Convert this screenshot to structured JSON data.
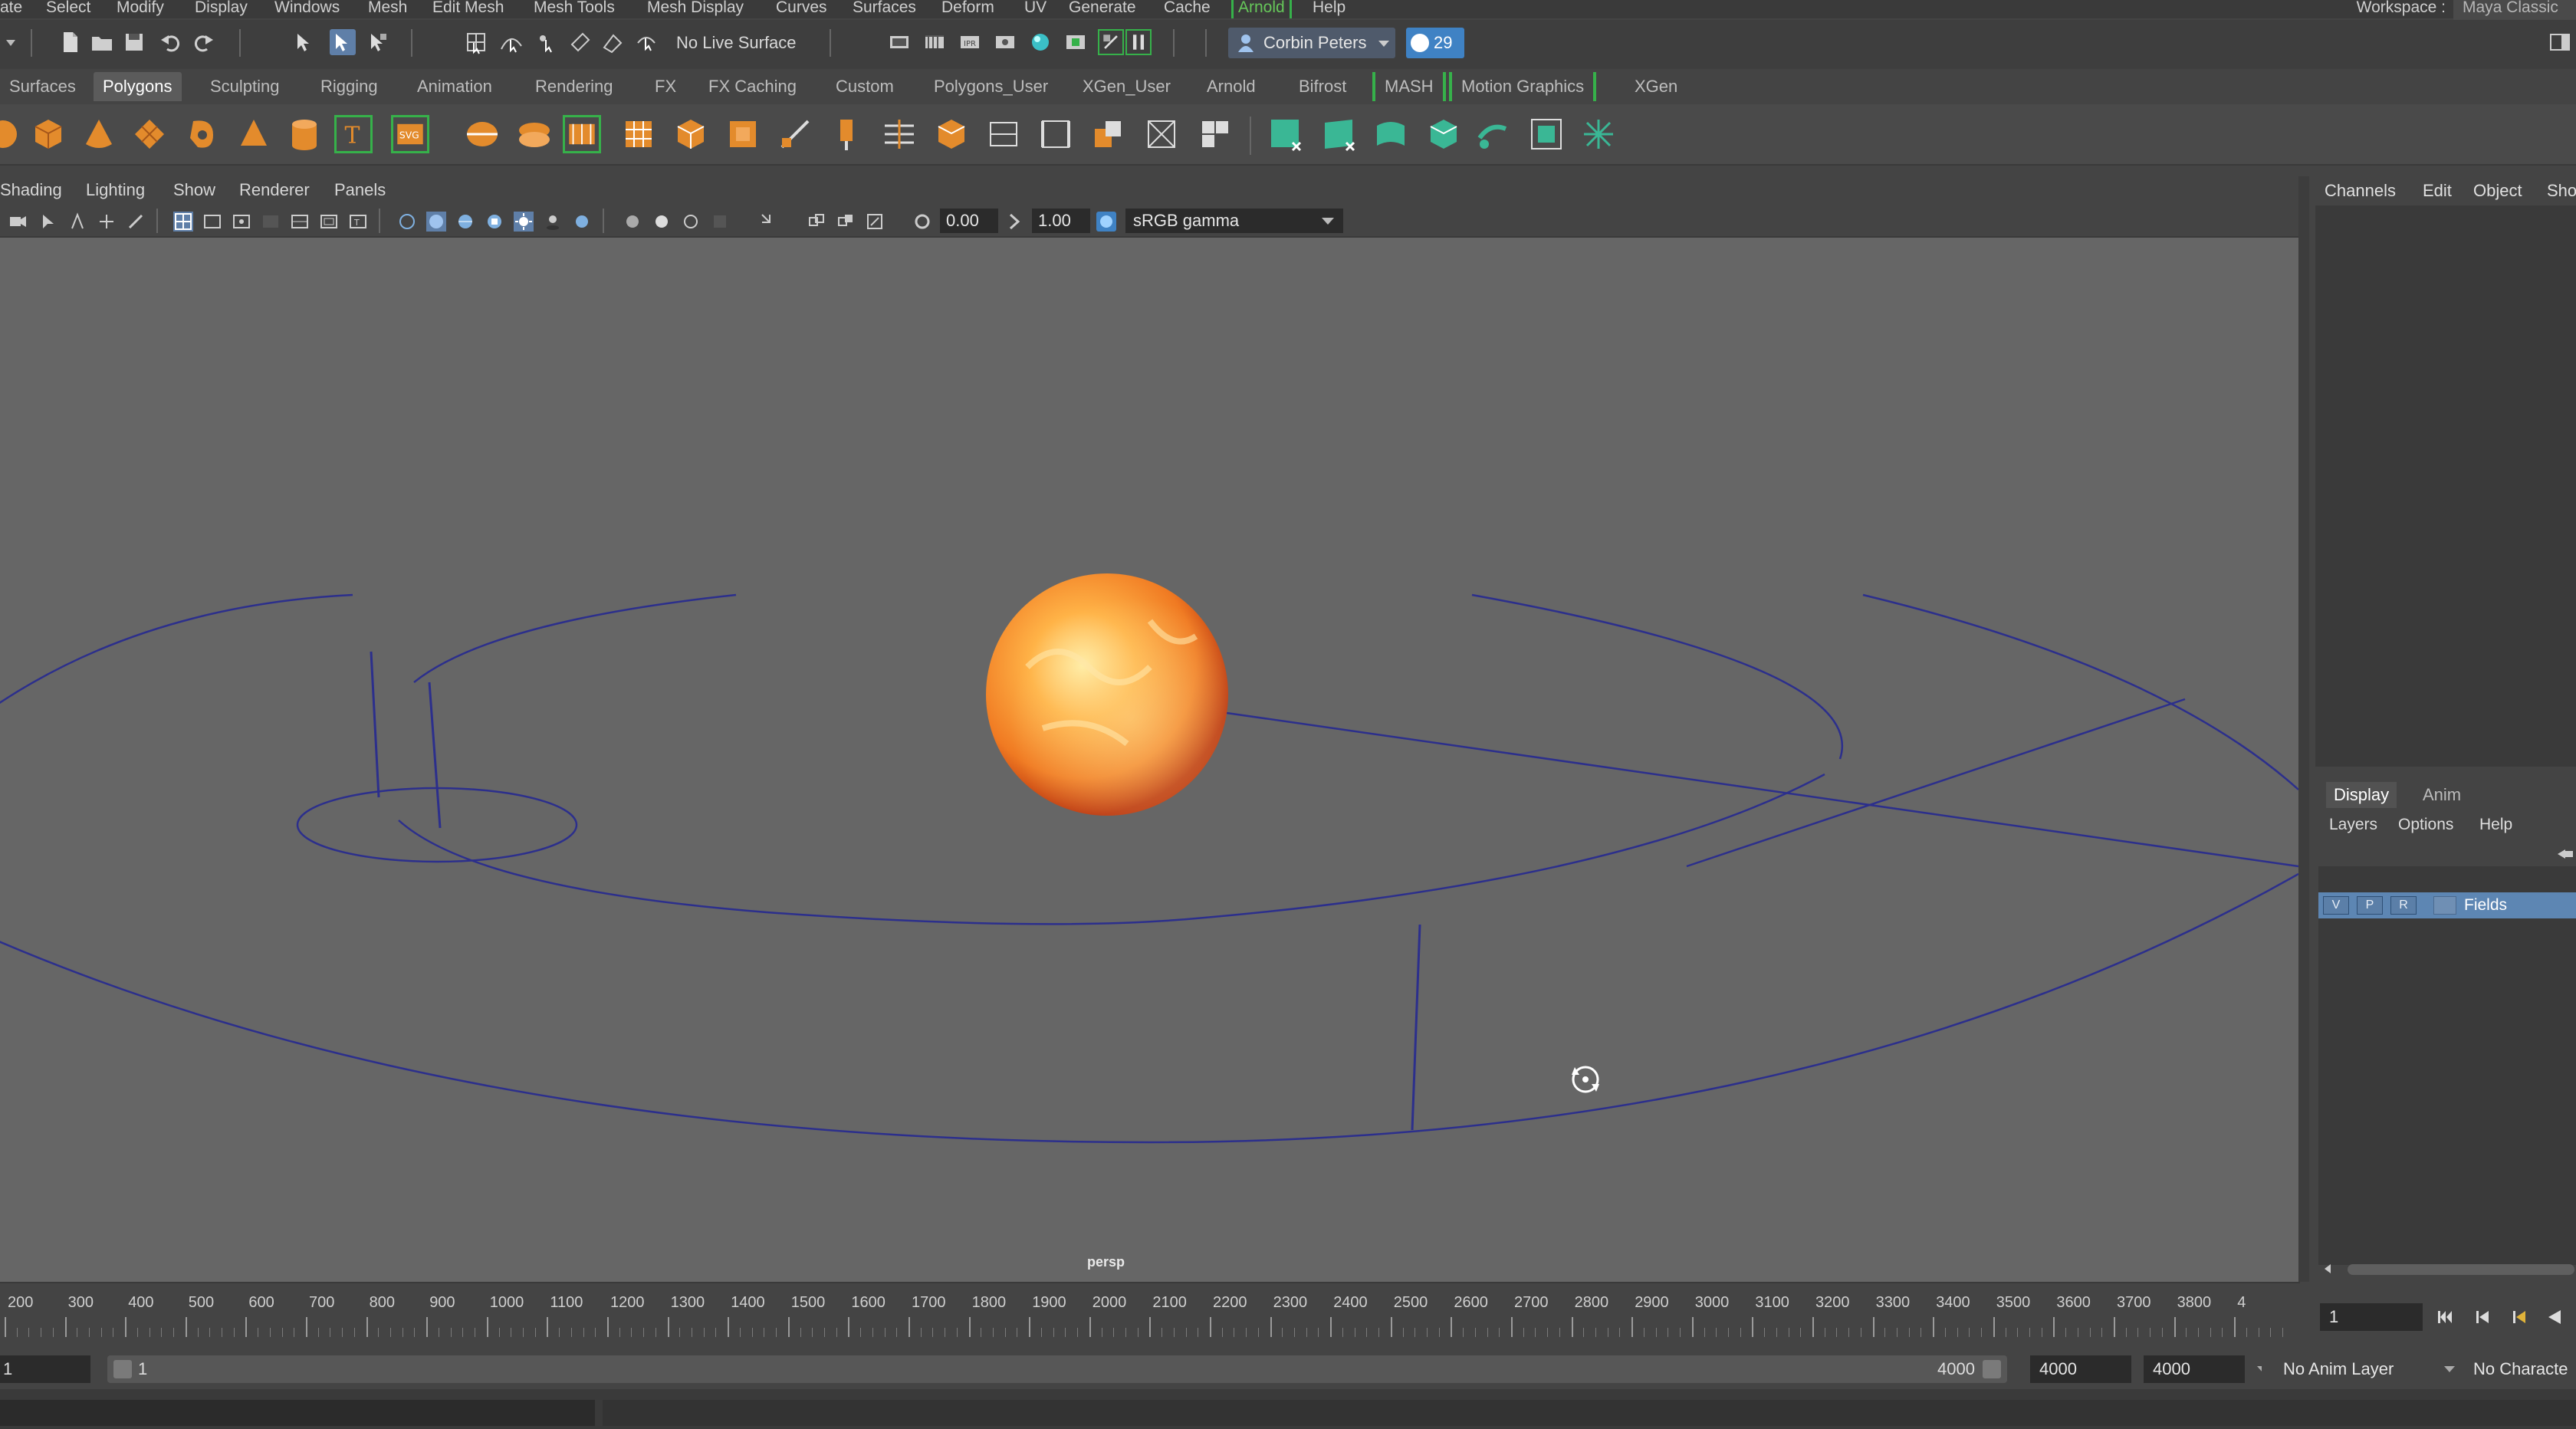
{
  "menubar": {
    "items": [
      "ate",
      "Select",
      "Modify",
      "Display",
      "Windows",
      "Mesh",
      "Edit Mesh",
      "Mesh Tools",
      "Mesh Display",
      "Curves",
      "Surfaces",
      "Deform",
      "UV",
      "Generate",
      "Cache",
      "Arnold",
      "Help"
    ],
    "workspace_label": "Workspace :",
    "workspace_value": "Maya Classic"
  },
  "statusline": {
    "live_surface": "No Live Surface",
    "user": "Corbin Peters",
    "notifications": "29"
  },
  "shelf": {
    "tabs": [
      "Surfaces",
      "Polygons",
      "Sculpting",
      "Rigging",
      "Animation",
      "Rendering",
      "FX",
      "FX Caching",
      "Custom",
      "Polygons_User",
      "XGen_User",
      "Arnold",
      "Bifrost",
      "MASH",
      "Motion Graphics",
      "XGen"
    ],
    "active_tab": "Polygons"
  },
  "viewport": {
    "menus": [
      "Shading",
      "Lighting",
      "Show",
      "Renderer",
      "Panels"
    ],
    "exposure": "0.00",
    "gamma": "1.00",
    "color_space": "sRGB gamma",
    "camera": "persp"
  },
  "channelbox": {
    "menus": [
      "Channels",
      "Edit",
      "Object",
      "Sho"
    ]
  },
  "layer_editor": {
    "tabs": [
      "Display",
      "Anim"
    ],
    "active_tab": "Display",
    "menus": [
      "Layers",
      "Options",
      "Help"
    ],
    "layer": {
      "v": "V",
      "p": "P",
      "r": "R",
      "name": "Fields"
    }
  },
  "timeslider": {
    "ticks": [
      "200",
      "300",
      "400",
      "500",
      "600",
      "700",
      "800",
      "900",
      "1000",
      "1100",
      "1200",
      "1300",
      "1400",
      "1500",
      "1600",
      "1700",
      "1800",
      "1900",
      "2000",
      "2100",
      "2200",
      "2300",
      "2400",
      "2500",
      "2600",
      "2700",
      "2800",
      "2900",
      "3000",
      "3100",
      "3200",
      "3300",
      "3400",
      "3500",
      "3600",
      "3700",
      "3800",
      "4"
    ],
    "current_frame": "1"
  },
  "range": {
    "start": "1",
    "inner_start": "1",
    "inner_end": "4000",
    "end": "4000",
    "anim_end": "4000",
    "anim_layer": "No Anim Layer",
    "character": "No Characte"
  },
  "colors": {
    "sun_core": "#ffb347",
    "sun_edge": "#e2561c",
    "orbit_line": "#2c2f8c",
    "viewport_bg": "#666666",
    "layer_highlight": "#5d86b3",
    "accent_green": "#36b14a"
  }
}
